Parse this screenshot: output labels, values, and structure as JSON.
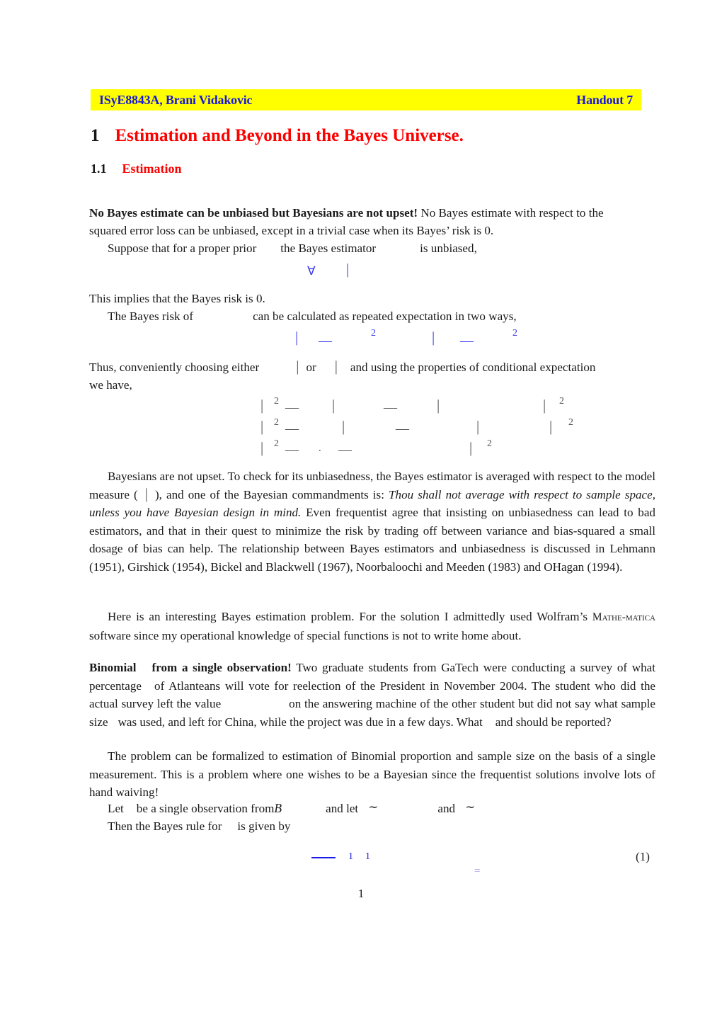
{
  "header": {
    "course": "ISyE8843A, Brani Vidakovic",
    "handout": "Handout 7",
    "banner_color": "#ffff00",
    "text_color": "#1a18d8"
  },
  "headings": {
    "section_number": "1",
    "section_title": "Estimation and Beyond in the Bayes Universe.",
    "subsection_number": "1.1",
    "subsection_title": "Estimation",
    "heading_color": "#ff0000"
  },
  "body": {
    "p1_bold": "No Bayes estimate can be unbiased but Bayesians are not upset!",
    "p1_rest_a": " No Bayes estimate with respect to the",
    "p1_line2": "squared error loss can be unbiased, except in a trivial case when its Bayes’ risk is 0.",
    "p1_line3_a": "Suppose that for a proper prior",
    "p1_line3_b": "the Bayes estimator",
    "p1_line3_c": "is unbiased,",
    "p2_line1": "This implies that the Bayes risk is 0.",
    "p2_line2_a": "The Bayes risk of",
    "p2_line2_b": "can be calculated as repeated expectation in two ways,",
    "p3_line1_a": "Thus, conveniently choosing either",
    "p3_line1_b": "or",
    "p3_line1_c": "and using the properties of conditional expectation",
    "p3_line2": "we have,",
    "p4_a": "Bayesians are not upset. To check for its unbiasedness, the Bayes estimator is averaged with respect to the model measure (",
    "p4_b": "), and one of the Bayesian commandments is: ",
    "p4_italic": "Thou shall not average with respect to sample space, unless you have Bayesian design in mind.",
    "p4_c": " Even frequentist agree that insisting on unbiasedness can lead to bad estimators, and that in their quest to minimize the risk by trading off between variance and bias-squared a small dosage of bias can help. The relationship between Bayes estimators and unbiasedness is discussed in Lehmann (1951), Girshick (1954), Bickel and Blackwell (1967), Noorbaloochi and Meeden (1983) and OHagan (1994).",
    "p5_a": "Here is an interesting Bayes estimation problem. For the solution I admittedly used Wolfram’s ",
    "p5_smallcaps_1": "Mathe-",
    "p5_smallcaps_2": "matica",
    "p5_b": " software since my operational knowledge of special functions is not to write home about.",
    "p6_bold_a": "Binomial",
    "p6_bold_b": "from a single observation!",
    "p6_a": " Two graduate students from GaTech were conducting a survey of what percentage",
    "p6_b": "of Atlanteans will vote for reelection of the President in November 2004. The student who did the actual survey left the value",
    "p6_c": "on the answering machine of the other student but did not say what sample size",
    "p6_d": "was used, and left for China, while the project was due in a few days. What",
    "p6_e": "and should be reported?",
    "p7": "The problem can be formalized to estimation of Binomial proportion and sample size on the basis of a single measurement. This is a problem where one wishes to be a Bayesian since the frequentist solutions involve lots of hand waiving!",
    "p8_a": "Let",
    "p8_b": "be a single observation from",
    "p8_calB": "B",
    "p8_c": "and let",
    "p8_tilde1": "∼",
    "p8_d": "and",
    "p8_tilde2": "∼",
    "p8_line2_a": "Then the Bayes rule for",
    "p8_line2_b": "is given by"
  },
  "math_fragments": {
    "row_forall": {
      "forall_glyph": "∀",
      "bar_glyph": "|",
      "color": "#3a3af0"
    },
    "row_tworisks": {
      "bar_glyph": "|",
      "minus_glyph": "—",
      "sup_glyph": "2",
      "color": "#3a3af0"
    },
    "row_threelines": {
      "bar_glyph": "|",
      "minus_glyph": "—",
      "sup_glyph": "2",
      "dot_glyph": ".",
      "color": "#555555"
    },
    "equation_1": {
      "number": "(1)",
      "subscript_1": "1",
      "subscript_2": "1",
      "equals_glyph": "=",
      "bar_color": "#1a1ae8"
    }
  },
  "footer": {
    "page_number": "1"
  }
}
